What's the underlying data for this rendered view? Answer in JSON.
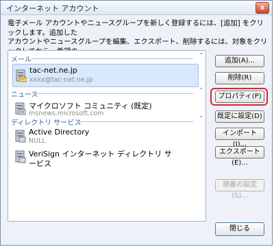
{
  "window": {
    "title": "インターネット アカウント",
    "close_label": "x"
  },
  "description": "電子メール アカウントやニュースグループを新しく登録するには、[追加] をクリックします。追加した\nアカウントやニュースグループを編集、エクスポート、削除するには、対象をクリックしてから、希望の\n動作をクリックします。",
  "groups": [
    {
      "label": "メール",
      "chevron": "˄",
      "items": [
        {
          "name": "tac-net.ne.jp",
          "sub": "xxxx@tac-net.ne.jp",
          "icon": "mail-account-icon"
        }
      ]
    },
    {
      "label": "ニュース",
      "chevron": "˄",
      "items": [
        {
          "name": "マイクロソフト コミュニティ (既定)",
          "sub": "msnews.microsoft.com",
          "icon": "news-server-icon"
        }
      ]
    },
    {
      "label": "ディレクトリ サービス",
      "chevron": "˄",
      "items": [
        {
          "name": "Active Directory",
          "sub": "NULL",
          "icon": "directory-server-icon"
        },
        {
          "name": "VeriSign インターネット ディレクトリ サ",
          "name2": "ービス",
          "icon": "directory-server-icon"
        }
      ]
    }
  ],
  "buttons": {
    "add": "追加(A)...",
    "delete": "削除(R)",
    "properties": "プロパティ(P)",
    "set_default": "既定に設定(D)",
    "import": "インポート(I)...",
    "export": "エクスポート(E)...",
    "order": "順番の設定(S)...",
    "close": "閉じる"
  },
  "colors": {
    "accent": "#2a5da6",
    "highlight": "#e0242b"
  }
}
